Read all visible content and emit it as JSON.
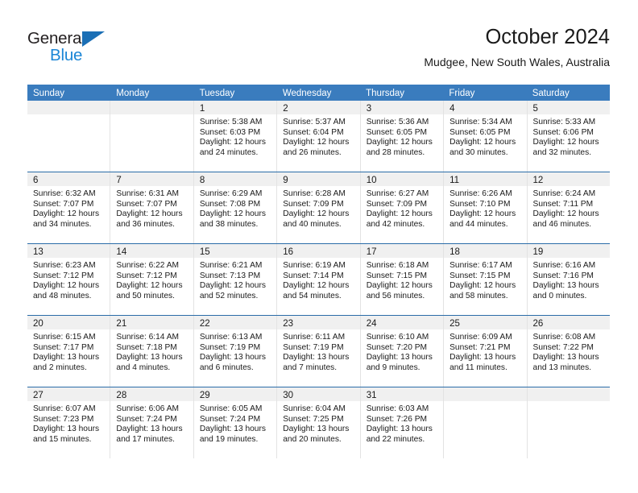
{
  "brand": {
    "name_top": "General",
    "name_bottom": "Blue",
    "triangle_color": "#1b6fb5",
    "blue_text_color": "#1b86d6"
  },
  "header": {
    "title": "October 2024",
    "subtitle": "Mudgee, New South Wales, Australia"
  },
  "theme": {
    "header_bar_color": "#3a7cbe",
    "row_divider_color": "#2b6ca8",
    "day_band_color": "#f0f0f0"
  },
  "weekdays": [
    "Sunday",
    "Monday",
    "Tuesday",
    "Wednesday",
    "Thursday",
    "Friday",
    "Saturday"
  ],
  "weeks": [
    [
      {
        "day": "",
        "lines": []
      },
      {
        "day": "",
        "lines": []
      },
      {
        "day": "1",
        "lines": [
          "Sunrise: 5:38 AM",
          "Sunset: 6:03 PM",
          "Daylight: 12 hours",
          "and 24 minutes."
        ]
      },
      {
        "day": "2",
        "lines": [
          "Sunrise: 5:37 AM",
          "Sunset: 6:04 PM",
          "Daylight: 12 hours",
          "and 26 minutes."
        ]
      },
      {
        "day": "3",
        "lines": [
          "Sunrise: 5:36 AM",
          "Sunset: 6:05 PM",
          "Daylight: 12 hours",
          "and 28 minutes."
        ]
      },
      {
        "day": "4",
        "lines": [
          "Sunrise: 5:34 AM",
          "Sunset: 6:05 PM",
          "Daylight: 12 hours",
          "and 30 minutes."
        ]
      },
      {
        "day": "5",
        "lines": [
          "Sunrise: 5:33 AM",
          "Sunset: 6:06 PM",
          "Daylight: 12 hours",
          "and 32 minutes."
        ]
      }
    ],
    [
      {
        "day": "6",
        "lines": [
          "Sunrise: 6:32 AM",
          "Sunset: 7:07 PM",
          "Daylight: 12 hours",
          "and 34 minutes."
        ]
      },
      {
        "day": "7",
        "lines": [
          "Sunrise: 6:31 AM",
          "Sunset: 7:07 PM",
          "Daylight: 12 hours",
          "and 36 minutes."
        ]
      },
      {
        "day": "8",
        "lines": [
          "Sunrise: 6:29 AM",
          "Sunset: 7:08 PM",
          "Daylight: 12 hours",
          "and 38 minutes."
        ]
      },
      {
        "day": "9",
        "lines": [
          "Sunrise: 6:28 AM",
          "Sunset: 7:09 PM",
          "Daylight: 12 hours",
          "and 40 minutes."
        ]
      },
      {
        "day": "10",
        "lines": [
          "Sunrise: 6:27 AM",
          "Sunset: 7:09 PM",
          "Daylight: 12 hours",
          "and 42 minutes."
        ]
      },
      {
        "day": "11",
        "lines": [
          "Sunrise: 6:26 AM",
          "Sunset: 7:10 PM",
          "Daylight: 12 hours",
          "and 44 minutes."
        ]
      },
      {
        "day": "12",
        "lines": [
          "Sunrise: 6:24 AM",
          "Sunset: 7:11 PM",
          "Daylight: 12 hours",
          "and 46 minutes."
        ]
      }
    ],
    [
      {
        "day": "13",
        "lines": [
          "Sunrise: 6:23 AM",
          "Sunset: 7:12 PM",
          "Daylight: 12 hours",
          "and 48 minutes."
        ]
      },
      {
        "day": "14",
        "lines": [
          "Sunrise: 6:22 AM",
          "Sunset: 7:12 PM",
          "Daylight: 12 hours",
          "and 50 minutes."
        ]
      },
      {
        "day": "15",
        "lines": [
          "Sunrise: 6:21 AM",
          "Sunset: 7:13 PM",
          "Daylight: 12 hours",
          "and 52 minutes."
        ]
      },
      {
        "day": "16",
        "lines": [
          "Sunrise: 6:19 AM",
          "Sunset: 7:14 PM",
          "Daylight: 12 hours",
          "and 54 minutes."
        ]
      },
      {
        "day": "17",
        "lines": [
          "Sunrise: 6:18 AM",
          "Sunset: 7:15 PM",
          "Daylight: 12 hours",
          "and 56 minutes."
        ]
      },
      {
        "day": "18",
        "lines": [
          "Sunrise: 6:17 AM",
          "Sunset: 7:15 PM",
          "Daylight: 12 hours",
          "and 58 minutes."
        ]
      },
      {
        "day": "19",
        "lines": [
          "Sunrise: 6:16 AM",
          "Sunset: 7:16 PM",
          "Daylight: 13 hours",
          "and 0 minutes."
        ]
      }
    ],
    [
      {
        "day": "20",
        "lines": [
          "Sunrise: 6:15 AM",
          "Sunset: 7:17 PM",
          "Daylight: 13 hours",
          "and 2 minutes."
        ]
      },
      {
        "day": "21",
        "lines": [
          "Sunrise: 6:14 AM",
          "Sunset: 7:18 PM",
          "Daylight: 13 hours",
          "and 4 minutes."
        ]
      },
      {
        "day": "22",
        "lines": [
          "Sunrise: 6:13 AM",
          "Sunset: 7:19 PM",
          "Daylight: 13 hours",
          "and 6 minutes."
        ]
      },
      {
        "day": "23",
        "lines": [
          "Sunrise: 6:11 AM",
          "Sunset: 7:19 PM",
          "Daylight: 13 hours",
          "and 7 minutes."
        ]
      },
      {
        "day": "24",
        "lines": [
          "Sunrise: 6:10 AM",
          "Sunset: 7:20 PM",
          "Daylight: 13 hours",
          "and 9 minutes."
        ]
      },
      {
        "day": "25",
        "lines": [
          "Sunrise: 6:09 AM",
          "Sunset: 7:21 PM",
          "Daylight: 13 hours",
          "and 11 minutes."
        ]
      },
      {
        "day": "26",
        "lines": [
          "Sunrise: 6:08 AM",
          "Sunset: 7:22 PM",
          "Daylight: 13 hours",
          "and 13 minutes."
        ]
      }
    ],
    [
      {
        "day": "27",
        "lines": [
          "Sunrise: 6:07 AM",
          "Sunset: 7:23 PM",
          "Daylight: 13 hours",
          "and 15 minutes."
        ]
      },
      {
        "day": "28",
        "lines": [
          "Sunrise: 6:06 AM",
          "Sunset: 7:24 PM",
          "Daylight: 13 hours",
          "and 17 minutes."
        ]
      },
      {
        "day": "29",
        "lines": [
          "Sunrise: 6:05 AM",
          "Sunset: 7:24 PM",
          "Daylight: 13 hours",
          "and 19 minutes."
        ]
      },
      {
        "day": "30",
        "lines": [
          "Sunrise: 6:04 AM",
          "Sunset: 7:25 PM",
          "Daylight: 13 hours",
          "and 20 minutes."
        ]
      },
      {
        "day": "31",
        "lines": [
          "Sunrise: 6:03 AM",
          "Sunset: 7:26 PM",
          "Daylight: 13 hours",
          "and 22 minutes."
        ]
      },
      {
        "day": "",
        "lines": []
      },
      {
        "day": "",
        "lines": []
      }
    ]
  ]
}
